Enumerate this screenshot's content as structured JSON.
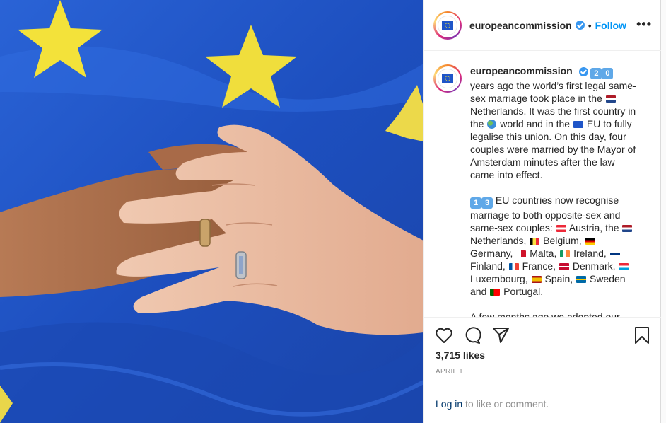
{
  "post": {
    "username": "europeancommission",
    "follow_label": "Follow",
    "more_label": "•••",
    "separator": "•"
  },
  "caption": {
    "username": "europeancommission",
    "p1_a": "years ago the world’s first legal same-sex marriage took place in the",
    "p1_b": "Netherlands. It was the first country in the",
    "p1_c": "world and in the",
    "p1_d": "EU to fully legalise this union. On this day, four couples were married by the Mayor of Amsterdam minutes after the law came into effect.",
    "p2_a": "EU countries now recognise marriage to both opposite-sex and same-sex couples:",
    "p2_austria": "Austria, the",
    "p2_netherlands": "Netherlands,",
    "p2_belgium": "Belgium,",
    "p2_germany": "Germany,",
    "p2_malta": "Malta,",
    "p2_ireland": "Ireland,",
    "p2_finland": "Finland,",
    "p2_france": "France,",
    "p2_denmark": "Denmark,",
    "p2_luxembourg": "Luxembourg,",
    "p2_spain": "Spain,",
    "p2_sweden": "Sweden and",
    "p2_portugal": "Portugal.",
    "p3": "A few months ago we adopted our first-ever strategy on LGBTIQ equality",
    "keycap_2": "2",
    "keycap_0": "0",
    "keycap_1": "1",
    "keycap_3": "3"
  },
  "actions": {
    "likes": "3,715 likes",
    "date": "APRIL 1",
    "login_label": "Log in",
    "comment_prompt": " to like or comment."
  },
  "icons": {
    "like": "heart-icon",
    "comment": "comment-icon",
    "share": "send-icon",
    "save": "bookmark-icon",
    "verified": "verified-badge-icon"
  },
  "colors": {
    "accent": "#0095f6",
    "verified": "#3897f0",
    "eu_blue": "#1f55c8",
    "eu_yellow": "#f3e23a"
  }
}
